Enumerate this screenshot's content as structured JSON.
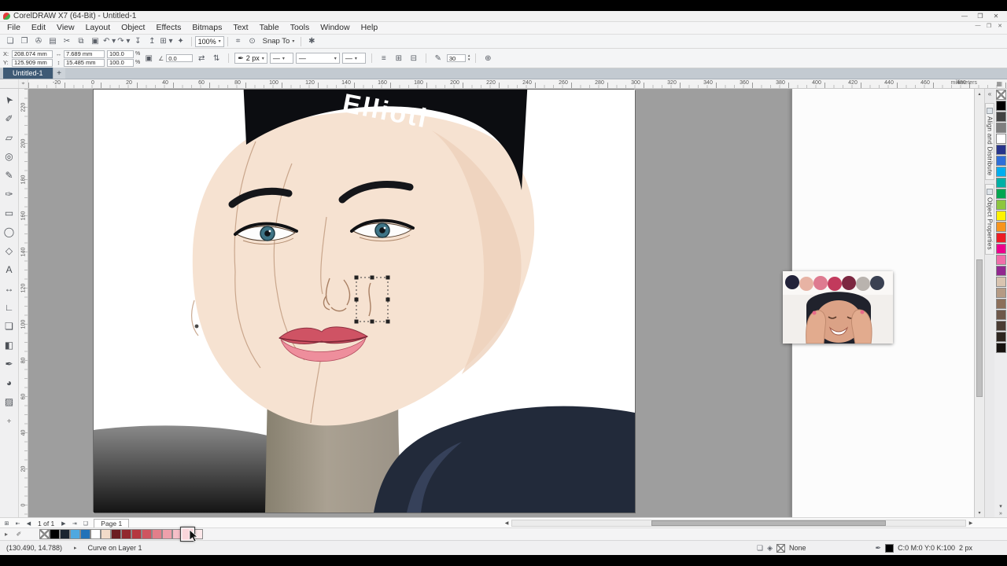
{
  "window": {
    "title": "CorelDRAW X7 (64-Bit) - Untitled-1",
    "controls": {
      "minimize": "—",
      "maximize": "❐",
      "close": "✕"
    }
  },
  "menubar": {
    "items": [
      "File",
      "Edit",
      "View",
      "Layout",
      "Object",
      "Effects",
      "Bitmaps",
      "Text",
      "Table",
      "Tools",
      "Window",
      "Help"
    ],
    "doc_controls": {
      "minimize": "—",
      "restore": "❐",
      "close": "✕"
    }
  },
  "stdbar": {
    "icons": [
      {
        "n": "new-document-icon",
        "g": "❏"
      },
      {
        "n": "open-icon",
        "g": "❐"
      },
      {
        "n": "save-icon",
        "g": "✇"
      },
      {
        "n": "print-icon",
        "g": "▤"
      },
      {
        "n": "cut-icon",
        "g": "✂"
      },
      {
        "n": "copy-icon",
        "g": "⧉"
      },
      {
        "n": "paste-icon",
        "g": "▣"
      },
      {
        "n": "undo-icon",
        "g": "↶ ▾"
      },
      {
        "n": "redo-icon",
        "g": "↷ ▾"
      },
      {
        "n": "import-icon",
        "g": "↧"
      },
      {
        "n": "export-icon",
        "g": "↥"
      },
      {
        "n": "application-launcher-icon",
        "g": "⊞ ▾"
      },
      {
        "n": "welcome-screen-icon",
        "g": "✦"
      }
    ],
    "zoom_value": "100%",
    "snap_icon_1": "⌗",
    "snap_icon_2": "⊙",
    "snap_label": "Snap To",
    "options_icon": "✱",
    "dropdown_glyph": "▾"
  },
  "propbar": {
    "x_label": "X:",
    "x_value": "208.074 mm",
    "y_label": "Y:",
    "y_value": "125.909 mm",
    "w_icon": "↔",
    "w_value": "7.689 mm",
    "h_icon": "↕",
    "h_value": "15.485 mm",
    "scale_x": "100.0",
    "scale_y": "100.0",
    "percent": "%",
    "lock_icon": "▣",
    "angle_icon": "∠",
    "angle_value": "0.0",
    "mirror_h_icon": "⇄",
    "mirror_v_icon": "⇅",
    "pen_icon": "✒",
    "outline_width": "2 px",
    "line_placeholder": "—",
    "extra_icon_1": "≡",
    "extra_icon_2": "⊞",
    "extra_icon_3": "⊟",
    "smooth_icon": "✎",
    "smooth_value": "30",
    "plus_icon": "⊕",
    "dropdown_glyph": "▾",
    "spin_up": "▴",
    "spin_down": "▾"
  },
  "doctabs": {
    "active": "Untitled-1",
    "add": "+"
  },
  "rulers": {
    "corner_icon": "⌖",
    "h_labels": [
      "-20",
      "0",
      "20",
      "40",
      "60",
      "80",
      "100",
      "120",
      "140",
      "160",
      "180",
      "200",
      "220",
      "240",
      "260",
      "280",
      "300",
      "320",
      "340",
      "360",
      "380",
      "400",
      "420",
      "440",
      "460",
      "480"
    ],
    "v_labels": [
      "220",
      "200",
      "180",
      "160",
      "140",
      "120",
      "100",
      "80",
      "60",
      "40",
      "20",
      "0"
    ],
    "unit": "millimeters",
    "options_icon": "▦"
  },
  "toolbox": {
    "tools": [
      {
        "n": "pick-tool",
        "g": "➤"
      },
      {
        "n": "shape-tool",
        "g": "✐"
      },
      {
        "n": "crop-tool",
        "g": "▱"
      },
      {
        "n": "zoom-tool",
        "g": "◎"
      },
      {
        "n": "freehand-tool",
        "g": "✎"
      },
      {
        "n": "artistic-media-tool",
        "g": "✑"
      },
      {
        "n": "rectangle-tool",
        "g": "▭"
      },
      {
        "n": "ellipse-tool",
        "g": "◯"
      },
      {
        "n": "polygon-tool",
        "g": "◇"
      },
      {
        "n": "text-tool",
        "g": "A"
      },
      {
        "n": "dimension-tool",
        "g": "↔"
      },
      {
        "n": "connector-tool",
        "g": "∟"
      },
      {
        "n": "drop-shadow-tool",
        "g": "❏"
      },
      {
        "n": "transparency-tool",
        "g": "◧"
      },
      {
        "n": "eyedropper-tool",
        "g": "✒"
      },
      {
        "n": "interactive-fill-tool",
        "g": "◕"
      },
      {
        "n": "smart-fill-tool",
        "g": "▨"
      }
    ],
    "more": "+"
  },
  "artwork": {
    "headband_text": "Ellioti"
  },
  "dockers": {
    "collapse": "«",
    "tabs": [
      {
        "label": "Align and Distribute"
      },
      {
        "label": "Object Properties"
      }
    ]
  },
  "pagebar": {
    "add_page": "⊞",
    "first": "⇤",
    "prev": "◀",
    "info": "1 of 1",
    "next": "▶",
    "last": "⇥",
    "page_icon": "❏",
    "page_tab": "Page 1",
    "scroll_left": "◀",
    "scroll_right": "▶"
  },
  "palettes": {
    "flyout_icon": "▸",
    "eyedropper_icon": "✐",
    "bottom": [
      "none",
      "#000000",
      "#1b2531",
      "#4fa8e0",
      "#2272b8",
      "#ffffff",
      "#f2dbc9",
      "#6b1d22",
      "#92282e",
      "#b5373f",
      "#cf5560",
      "#e27f8a",
      "#eea0ab",
      "#f5bfc8",
      "#f9d6db",
      "#fce8ea"
    ],
    "bottom_selected_index": 14,
    "right": [
      "none",
      "#000000",
      "#434343",
      "#7f7f7f",
      "#ffffff",
      "#27348b",
      "#2e6fd9",
      "#00aeef",
      "#00b0a6",
      "#00a651",
      "#8dc63f",
      "#fff200",
      "#f7941d",
      "#ed1c24",
      "#ec008c",
      "#f06eaa",
      "#92278f",
      "#d9c4b0",
      "#b59a84",
      "#8c6f5a",
      "#6e584a",
      "#4a3c33",
      "#2e2620",
      "#171310"
    ],
    "scroll_down": "▾",
    "flyout_more": "»"
  },
  "statusbar": {
    "coords": "(130.490, 14.788)",
    "expand": "▸",
    "object_info": "Curve on Layer 1",
    "doc_icon": "❏",
    "palette_icon": "◈",
    "fill_label": "None",
    "pen_icon": "✒",
    "outline_cmyk": "C:0 M:0 Y:0 K:100",
    "outline_width": "2 px"
  }
}
